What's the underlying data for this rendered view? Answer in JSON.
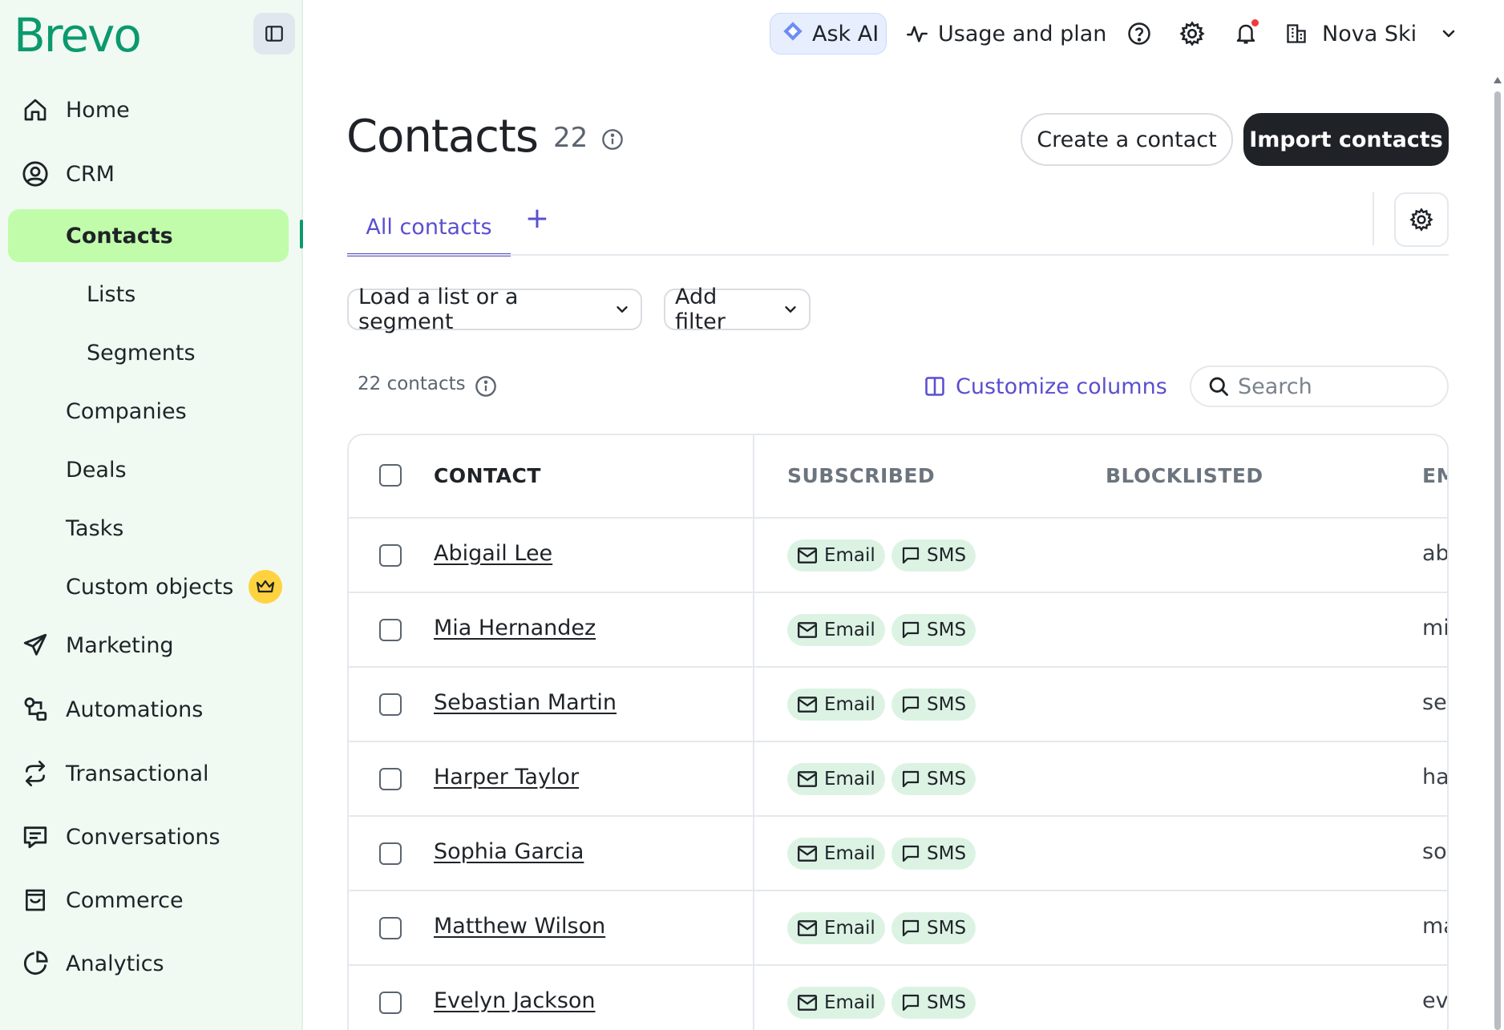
{
  "brand": {
    "logo_text": "Brevo",
    "accent": "#0b996e",
    "primary": "#5a4fcf"
  },
  "sidebar": {
    "items": [
      {
        "label": "Home",
        "icon": "home-icon"
      },
      {
        "label": "CRM",
        "icon": "user-circle-icon"
      },
      {
        "label": "Contacts",
        "active": true
      },
      {
        "label": "Lists",
        "sub": true
      },
      {
        "label": "Segments",
        "sub": true
      },
      {
        "label": "Companies"
      },
      {
        "label": "Deals"
      },
      {
        "label": "Tasks"
      },
      {
        "label": "Custom objects",
        "badge": "crown-icon"
      },
      {
        "label": "Marketing",
        "icon": "paper-plane-icon"
      },
      {
        "label": "Automations",
        "icon": "automation-icon"
      },
      {
        "label": "Transactional",
        "icon": "repeat-icon"
      },
      {
        "label": "Conversations",
        "icon": "chat-icon"
      },
      {
        "label": "Commerce",
        "icon": "shopping-bag-icon"
      },
      {
        "label": "Analytics",
        "icon": "pie-chart-icon"
      }
    ]
  },
  "topbar": {
    "ask_ai": "Ask AI",
    "usage": "Usage and plan",
    "account": "Nova Ski"
  },
  "page": {
    "title": "Contacts",
    "count": "22",
    "create_button": "Create a contact",
    "import_button": "Import contacts"
  },
  "tabs": {
    "all_contacts": "All contacts",
    "add": "+"
  },
  "filters": {
    "load_list": "Load a list or a segment",
    "add_filter": "Add filter"
  },
  "toolbar": {
    "contacts_count": "22 contacts",
    "customize": "Customize columns",
    "search_placeholder": "Search"
  },
  "table": {
    "headers": {
      "contact": "CONTACT",
      "subscribed": "SUBSCRIBED",
      "blocklisted": "BLOCKLISTED",
      "email": "EM"
    },
    "chip_email": "Email",
    "chip_sms": "SMS",
    "rows": [
      {
        "name": "Abigail Lee",
        "email": "ab"
      },
      {
        "name": "Mia Hernandez",
        "email": "mia"
      },
      {
        "name": "Sebastian Martin",
        "email": "seb"
      },
      {
        "name": "Harper Taylor",
        "email": "ha"
      },
      {
        "name": "Sophia Garcia",
        "email": "sop"
      },
      {
        "name": "Matthew Wilson",
        "email": "ma"
      },
      {
        "name": "Evelyn Jackson",
        "email": "eve"
      }
    ]
  }
}
